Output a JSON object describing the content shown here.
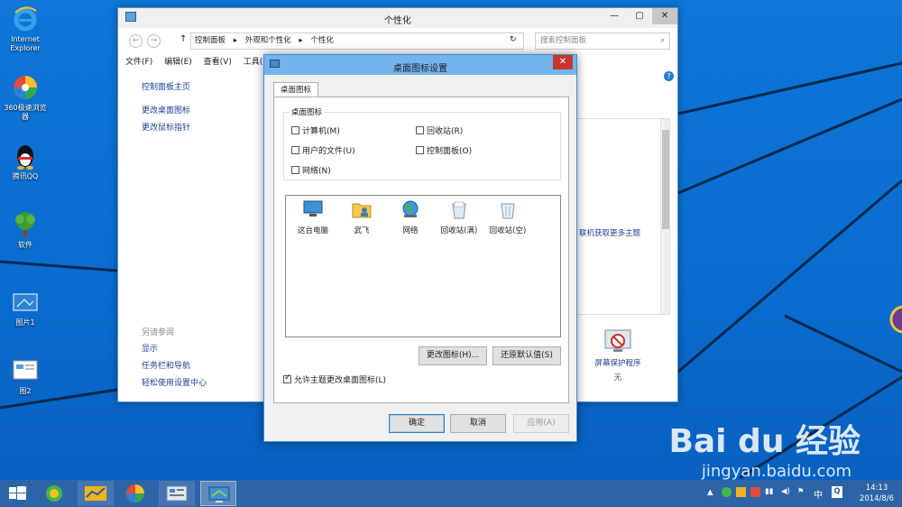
{
  "desktop": {
    "icons": [
      {
        "label": "Internet\nExplorer"
      },
      {
        "label": "360极速浏览\n器"
      },
      {
        "label": "腾讯QQ"
      },
      {
        "label": "软件"
      },
      {
        "label": "图片1"
      },
      {
        "label": "图2"
      }
    ]
  },
  "window": {
    "title": "个性化",
    "breadcrumbs": [
      "控制面板",
      "▸",
      "外观和个性化",
      "▸",
      "个性化"
    ],
    "search_placeholder": "搜索控制面板",
    "menu": [
      "文件(F)",
      "编辑(E)",
      "查看(V)",
      "工具("
    ],
    "sidebar_home": "控制面板主页",
    "sidebar_links": [
      "更改桌面图标",
      "更改鼠标指针"
    ],
    "see_also_title": "另请参阅",
    "see_also": [
      "显示",
      "任务栏和导航",
      "轻松使用设置中心"
    ],
    "online_themes_link": "联机获取更多主题",
    "screensaver_label": "屏幕保护程序",
    "screensaver_value": "无",
    "help_icon": "?"
  },
  "dialog": {
    "title": "桌面图标设置",
    "close": "✕",
    "tab": "桌面图标",
    "group_title": "桌面图标",
    "checkboxes": [
      {
        "label": "计算机(M)",
        "checked": false
      },
      {
        "label": "回收站(R)",
        "checked": false
      },
      {
        "label": "用户的文件(U)",
        "checked": false
      },
      {
        "label": "控制面板(O)",
        "checked": false
      },
      {
        "label": "网络(N)",
        "checked": false
      }
    ],
    "icons": [
      "这台电脑",
      "武飞",
      "网络",
      "回收站(满)",
      "回收站(空)"
    ],
    "change_icon": "更改图标(H)...",
    "restore_default": "还原默认值(S)",
    "allow_themes": {
      "label": "允许主题更改桌面图标(L)",
      "checked": true
    },
    "ok": "确定",
    "cancel": "取消",
    "apply": "应用(A)"
  },
  "taskbar": {
    "time": "14:13",
    "date": "2014/8/6",
    "ime": "中"
  },
  "watermark": {
    "logo": "Bai du 经验",
    "url": "jingyan.baidu.com"
  },
  "colors": {
    "desktop_blue": "#0b6fc9",
    "dialog_title": "#74b4ee",
    "close_red": "#c7362b",
    "taskbar": "#2c64a8"
  }
}
